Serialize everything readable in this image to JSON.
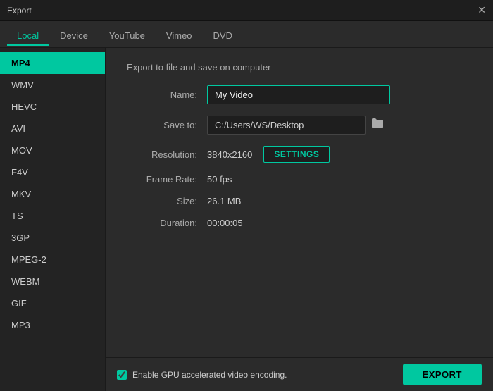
{
  "titleBar": {
    "title": "Export",
    "closeLabel": "✕"
  },
  "tabs": [
    {
      "id": "local",
      "label": "Local",
      "active": true
    },
    {
      "id": "device",
      "label": "Device",
      "active": false
    },
    {
      "id": "youtube",
      "label": "YouTube",
      "active": false
    },
    {
      "id": "vimeo",
      "label": "Vimeo",
      "active": false
    },
    {
      "id": "dvd",
      "label": "DVD",
      "active": false
    }
  ],
  "sidebar": {
    "items": [
      {
        "id": "mp4",
        "label": "MP4",
        "active": true
      },
      {
        "id": "wmv",
        "label": "WMV",
        "active": false
      },
      {
        "id": "hevc",
        "label": "HEVC",
        "active": false
      },
      {
        "id": "avi",
        "label": "AVI",
        "active": false
      },
      {
        "id": "mov",
        "label": "MOV",
        "active": false
      },
      {
        "id": "f4v",
        "label": "F4V",
        "active": false
      },
      {
        "id": "mkv",
        "label": "MKV",
        "active": false
      },
      {
        "id": "ts",
        "label": "TS",
        "active": false
      },
      {
        "id": "3gp",
        "label": "3GP",
        "active": false
      },
      {
        "id": "mpeg2",
        "label": "MPEG-2",
        "active": false
      },
      {
        "id": "webm",
        "label": "WEBM",
        "active": false
      },
      {
        "id": "gif",
        "label": "GIF",
        "active": false
      },
      {
        "id": "mp3",
        "label": "MP3",
        "active": false
      }
    ]
  },
  "content": {
    "sectionTitle": "Export to file and save on computer",
    "nameLabel": "Name:",
    "nameValue": "My Video",
    "namePlaceholder": "My Video",
    "saveToLabel": "Save to:",
    "saveToPath": "C:/Users/WS/Desktop",
    "folderIcon": "📁",
    "resolutionLabel": "Resolution:",
    "resolutionValue": "3840x2160",
    "settingsLabel": "SETTINGS",
    "frameRateLabel": "Frame Rate:",
    "frameRateValue": "50 fps",
    "sizeLabel": "Size:",
    "sizeValue": "26.1 MB",
    "durationLabel": "Duration:",
    "durationValue": "00:00:05"
  },
  "bottomBar": {
    "gpuCheckboxLabel": "Enable GPU accelerated video encoding.",
    "gpuChecked": true,
    "exportLabel": "EXPORT"
  }
}
